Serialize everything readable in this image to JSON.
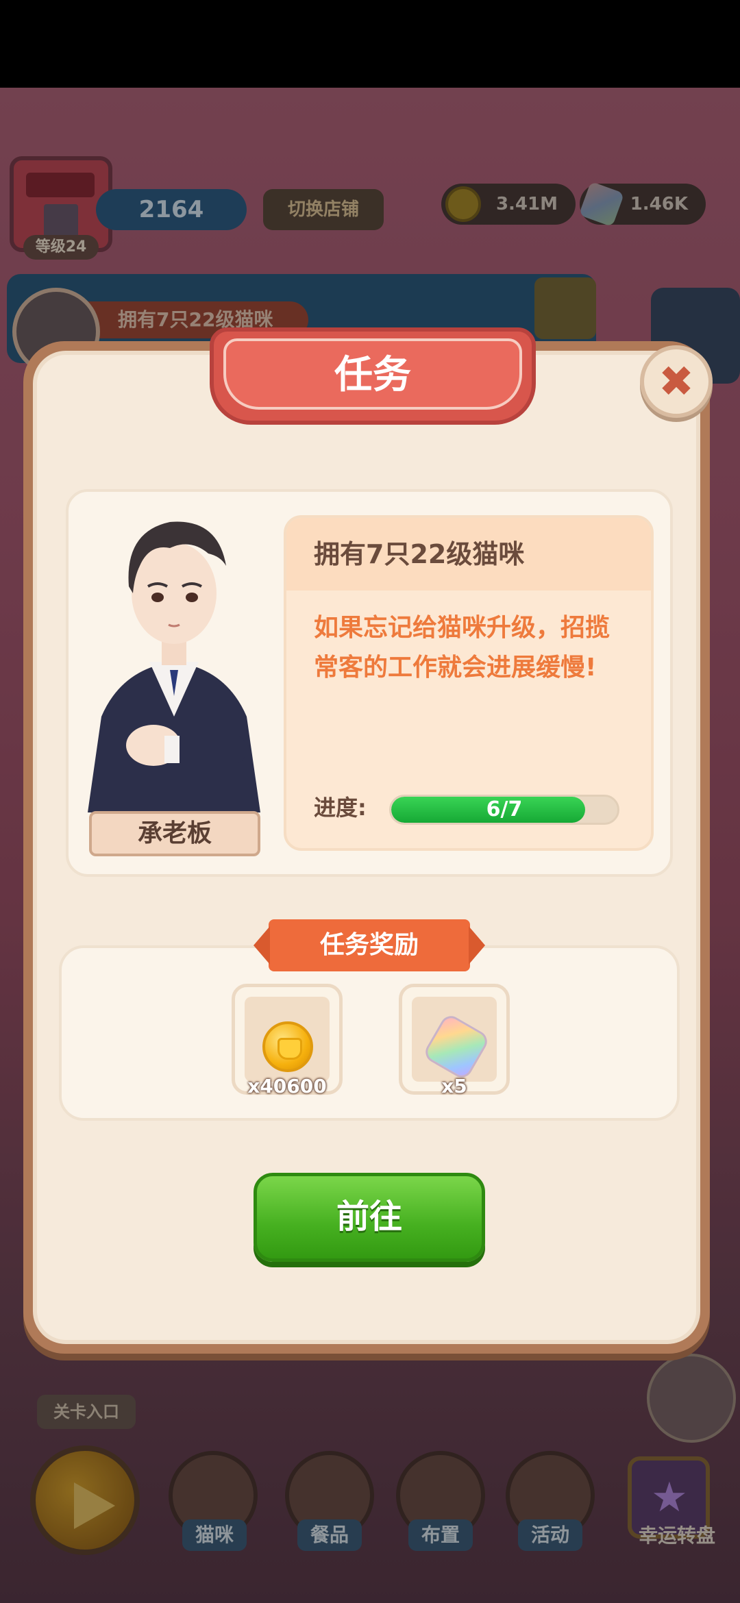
{
  "hud": {
    "shop_level": "等级24",
    "score": "2164",
    "switch_shop": "切换店铺",
    "coins": "3.41M",
    "gems": "1.46K",
    "banner_task": "拥有7只22级猫咪"
  },
  "modal": {
    "title": "任务",
    "close_symbol": "✖",
    "npc_name": "承老板",
    "task_title": "拥有7只22级猫咪",
    "task_desc": "如果忘记给猫咪升级，招揽常客的工作就会进展缓慢!",
    "progress_label": "进度:",
    "progress_text": "6/7",
    "progress_value": 0.857,
    "rewards_title": "任务奖励",
    "rewards": [
      {
        "icon": "coin-icon",
        "qty": "x40600"
      },
      {
        "icon": "gem-icon",
        "qty": "x5"
      }
    ],
    "go_button": "前往"
  },
  "bottom": {
    "stage_entry": "关卡入口",
    "nav": [
      "猫咪",
      "餐品",
      "布置",
      "活动"
    ],
    "lucky": "幸运转盘",
    "lucky_symbol": "★"
  }
}
